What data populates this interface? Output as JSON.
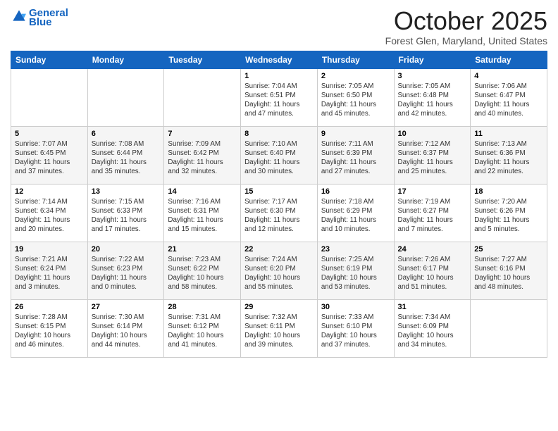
{
  "header": {
    "logo_line1": "General",
    "logo_line2": "Blue",
    "title": "October 2025",
    "subtitle": "Forest Glen, Maryland, United States"
  },
  "days_of_week": [
    "Sunday",
    "Monday",
    "Tuesday",
    "Wednesday",
    "Thursday",
    "Friday",
    "Saturday"
  ],
  "rows": [
    [
      {
        "day": "",
        "info": ""
      },
      {
        "day": "",
        "info": ""
      },
      {
        "day": "",
        "info": ""
      },
      {
        "day": "1",
        "info": "Sunrise: 7:04 AM\nSunset: 6:51 PM\nDaylight: 11 hours\nand 47 minutes."
      },
      {
        "day": "2",
        "info": "Sunrise: 7:05 AM\nSunset: 6:50 PM\nDaylight: 11 hours\nand 45 minutes."
      },
      {
        "day": "3",
        "info": "Sunrise: 7:05 AM\nSunset: 6:48 PM\nDaylight: 11 hours\nand 42 minutes."
      },
      {
        "day": "4",
        "info": "Sunrise: 7:06 AM\nSunset: 6:47 PM\nDaylight: 11 hours\nand 40 minutes."
      }
    ],
    [
      {
        "day": "5",
        "info": "Sunrise: 7:07 AM\nSunset: 6:45 PM\nDaylight: 11 hours\nand 37 minutes."
      },
      {
        "day": "6",
        "info": "Sunrise: 7:08 AM\nSunset: 6:44 PM\nDaylight: 11 hours\nand 35 minutes."
      },
      {
        "day": "7",
        "info": "Sunrise: 7:09 AM\nSunset: 6:42 PM\nDaylight: 11 hours\nand 32 minutes."
      },
      {
        "day": "8",
        "info": "Sunrise: 7:10 AM\nSunset: 6:40 PM\nDaylight: 11 hours\nand 30 minutes."
      },
      {
        "day": "9",
        "info": "Sunrise: 7:11 AM\nSunset: 6:39 PM\nDaylight: 11 hours\nand 27 minutes."
      },
      {
        "day": "10",
        "info": "Sunrise: 7:12 AM\nSunset: 6:37 PM\nDaylight: 11 hours\nand 25 minutes."
      },
      {
        "day": "11",
        "info": "Sunrise: 7:13 AM\nSunset: 6:36 PM\nDaylight: 11 hours\nand 22 minutes."
      }
    ],
    [
      {
        "day": "12",
        "info": "Sunrise: 7:14 AM\nSunset: 6:34 PM\nDaylight: 11 hours\nand 20 minutes."
      },
      {
        "day": "13",
        "info": "Sunrise: 7:15 AM\nSunset: 6:33 PM\nDaylight: 11 hours\nand 17 minutes."
      },
      {
        "day": "14",
        "info": "Sunrise: 7:16 AM\nSunset: 6:31 PM\nDaylight: 11 hours\nand 15 minutes."
      },
      {
        "day": "15",
        "info": "Sunrise: 7:17 AM\nSunset: 6:30 PM\nDaylight: 11 hours\nand 12 minutes."
      },
      {
        "day": "16",
        "info": "Sunrise: 7:18 AM\nSunset: 6:29 PM\nDaylight: 11 hours\nand 10 minutes."
      },
      {
        "day": "17",
        "info": "Sunrise: 7:19 AM\nSunset: 6:27 PM\nDaylight: 11 hours\nand 7 minutes."
      },
      {
        "day": "18",
        "info": "Sunrise: 7:20 AM\nSunset: 6:26 PM\nDaylight: 11 hours\nand 5 minutes."
      }
    ],
    [
      {
        "day": "19",
        "info": "Sunrise: 7:21 AM\nSunset: 6:24 PM\nDaylight: 11 hours\nand 3 minutes."
      },
      {
        "day": "20",
        "info": "Sunrise: 7:22 AM\nSunset: 6:23 PM\nDaylight: 11 hours\nand 0 minutes."
      },
      {
        "day": "21",
        "info": "Sunrise: 7:23 AM\nSunset: 6:22 PM\nDaylight: 10 hours\nand 58 minutes."
      },
      {
        "day": "22",
        "info": "Sunrise: 7:24 AM\nSunset: 6:20 PM\nDaylight: 10 hours\nand 55 minutes."
      },
      {
        "day": "23",
        "info": "Sunrise: 7:25 AM\nSunset: 6:19 PM\nDaylight: 10 hours\nand 53 minutes."
      },
      {
        "day": "24",
        "info": "Sunrise: 7:26 AM\nSunset: 6:17 PM\nDaylight: 10 hours\nand 51 minutes."
      },
      {
        "day": "25",
        "info": "Sunrise: 7:27 AM\nSunset: 6:16 PM\nDaylight: 10 hours\nand 48 minutes."
      }
    ],
    [
      {
        "day": "26",
        "info": "Sunrise: 7:28 AM\nSunset: 6:15 PM\nDaylight: 10 hours\nand 46 minutes."
      },
      {
        "day": "27",
        "info": "Sunrise: 7:30 AM\nSunset: 6:14 PM\nDaylight: 10 hours\nand 44 minutes."
      },
      {
        "day": "28",
        "info": "Sunrise: 7:31 AM\nSunset: 6:12 PM\nDaylight: 10 hours\nand 41 minutes."
      },
      {
        "day": "29",
        "info": "Sunrise: 7:32 AM\nSunset: 6:11 PM\nDaylight: 10 hours\nand 39 minutes."
      },
      {
        "day": "30",
        "info": "Sunrise: 7:33 AM\nSunset: 6:10 PM\nDaylight: 10 hours\nand 37 minutes."
      },
      {
        "day": "31",
        "info": "Sunrise: 7:34 AM\nSunset: 6:09 PM\nDaylight: 10 hours\nand 34 minutes."
      },
      {
        "day": "",
        "info": ""
      }
    ]
  ]
}
